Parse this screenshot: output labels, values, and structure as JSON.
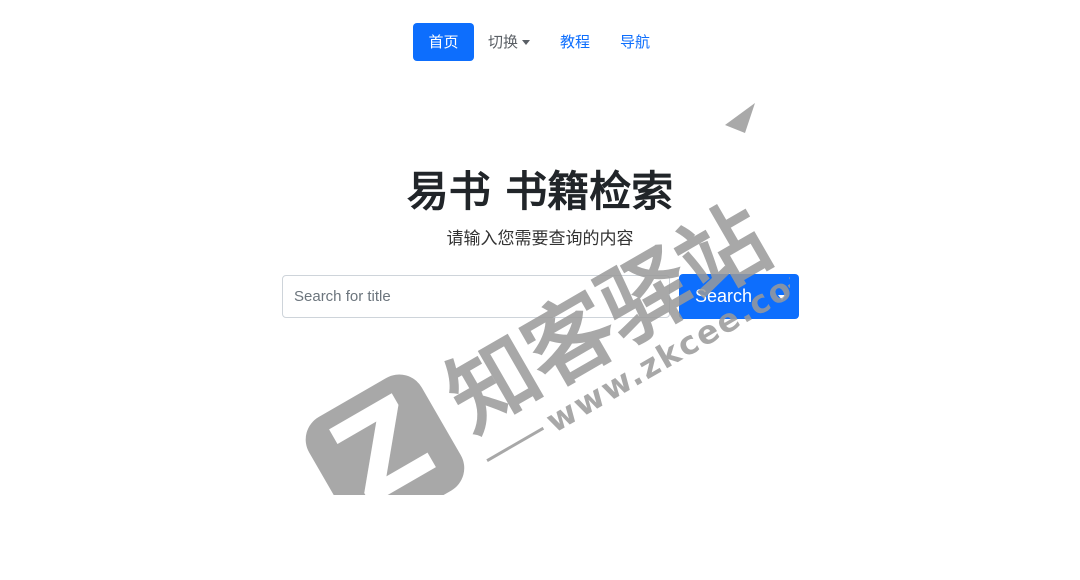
{
  "nav": {
    "items": [
      {
        "label": "首页",
        "active": true
      },
      {
        "label": "切换",
        "dropdown": true
      },
      {
        "label": "教程"
      },
      {
        "label": "导航"
      }
    ]
  },
  "hero": {
    "title": "易书 书籍检索",
    "subtitle": "请输入您需要查询的内容"
  },
  "search": {
    "placeholder": "Search for title",
    "value": "",
    "button_label": "Search"
  },
  "watermark": {
    "brand": "知客驿站",
    "url": "www.zkcee.com",
    "logo_letter": "Z"
  },
  "colors": {
    "primary": "#0d6efd",
    "watermark": "#9a9a9a"
  }
}
